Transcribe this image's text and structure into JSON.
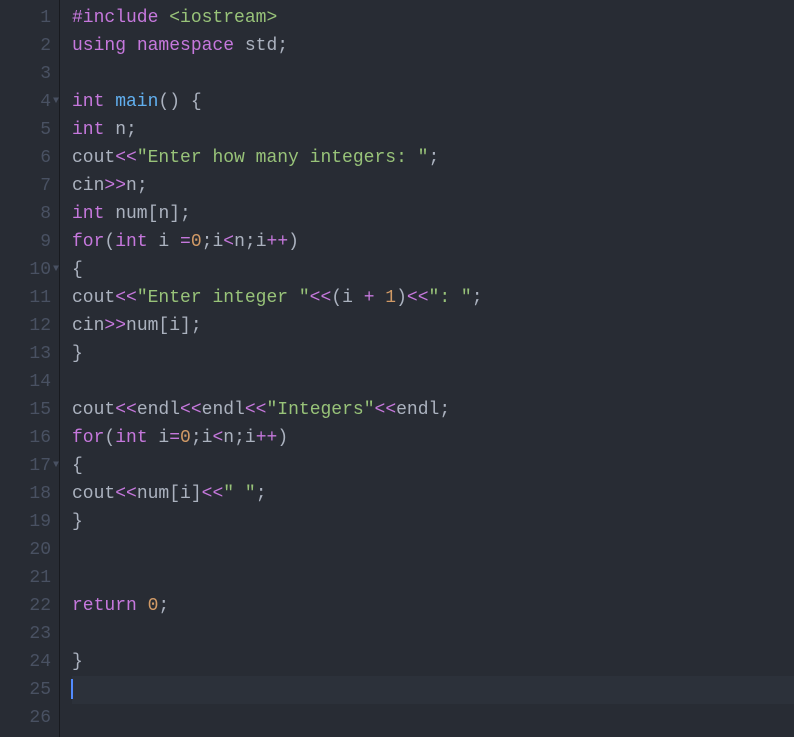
{
  "gutter": {
    "lines": [
      "1",
      "2",
      "3",
      "4",
      "5",
      "6",
      "7",
      "8",
      "9",
      "10",
      "11",
      "12",
      "13",
      "14",
      "15",
      "16",
      "17",
      "18",
      "19",
      "20",
      "21",
      "22",
      "23",
      "24",
      "25",
      "26"
    ],
    "foldable": [
      4,
      10,
      17
    ]
  },
  "code": {
    "line1": {
      "include": "#include",
      "lib": " <iostream>"
    },
    "line2": {
      "using": "using",
      "namespace": " namespace",
      "std": " std",
      "semi": ";"
    },
    "line4": {
      "int": "int",
      "main": " main",
      "parens": "() {"
    },
    "line5": {
      "int": "int",
      "n": " n",
      "semi": ";"
    },
    "line6": {
      "cout": "cout",
      "op1": "<<",
      "str": "\"Enter how many integers: \"",
      "semi": ";"
    },
    "line7": {
      "cin": "cin",
      "op": ">>",
      "n": "n",
      "semi": ";"
    },
    "line8": {
      "int": "int",
      "num": " num",
      "br1": "[",
      "n": "n",
      "br2": "];"
    },
    "line9": {
      "for": "for",
      "p1": "(",
      "int": "int",
      "i": " i ",
      "eq": "=",
      "zero": "0",
      "semi1": ";",
      "i2": "i",
      "lt": "<",
      "n": "n",
      "semi2": ";",
      "i3": "i",
      "pp": "++",
      "p2": ")"
    },
    "line10": {
      "brace": "{"
    },
    "line11": {
      "cout": "cout",
      "op1": "<<",
      "str1": "\"Enter integer \"",
      "op2": "<<",
      "p1": "(",
      "i": "i ",
      "plus": "+",
      "one": " 1",
      "p2": ")",
      "op3": "<<",
      "str2": "\": \"",
      "semi": ";"
    },
    "line12": {
      "cin": "cin",
      "op": ">>",
      "num": "num",
      "br1": "[",
      "i": "i",
      "br2": "];"
    },
    "line13": {
      "brace": "}"
    },
    "line15": {
      "cout": "cout",
      "op1": "<<",
      "endl1": "endl",
      "op2": "<<",
      "endl2": "endl",
      "op3": "<<",
      "str": "\"Integers\"",
      "op4": "<<",
      "endl3": "endl",
      "semi": ";"
    },
    "line16": {
      "for": "for",
      "p1": "(",
      "int": "int",
      "i": " i",
      "eq": "=",
      "zero": "0",
      "semi1": ";",
      "i2": "i",
      "lt": "<",
      "n": "n",
      "semi2": ";",
      "i3": "i",
      "pp": "++",
      "p2": ")"
    },
    "line17": {
      "brace": "{"
    },
    "line18": {
      "cout": "cout",
      "op1": "<<",
      "num": "num",
      "br1": "[",
      "i": "i",
      "br2": "]",
      "op2": "<<",
      "str": "\" \"",
      "semi": ";"
    },
    "line19": {
      "brace": "}"
    },
    "line22": {
      "return": "return",
      "zero": " 0",
      "semi": ";"
    },
    "line24": {
      "brace": "}"
    }
  }
}
